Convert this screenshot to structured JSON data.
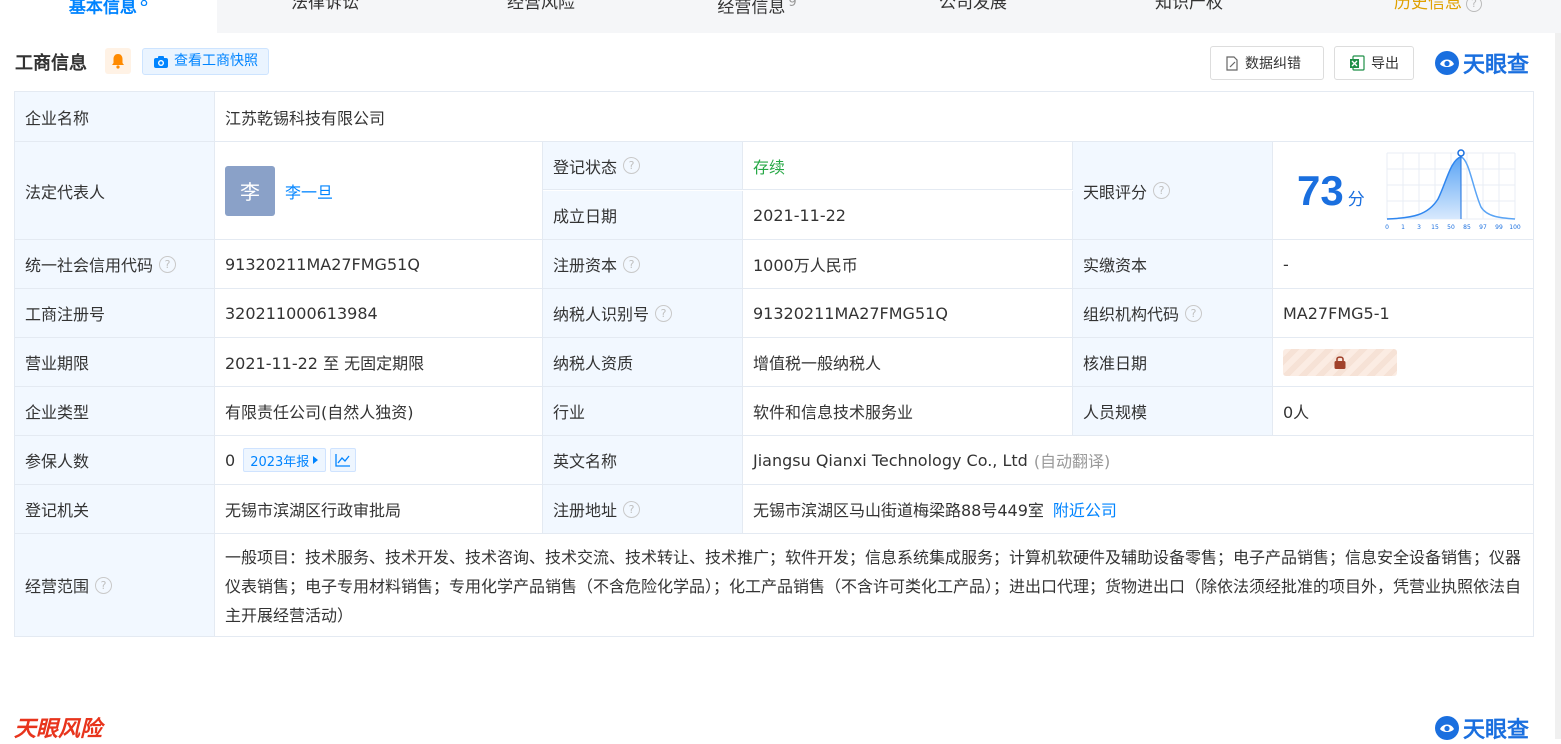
{
  "tabs": [
    {
      "label": "基本信息",
      "count": "8"
    },
    {
      "label": "法律诉讼"
    },
    {
      "label": "经营风险"
    },
    {
      "label": "经营信息",
      "count": "9"
    },
    {
      "label": "公司发展"
    },
    {
      "label": "知识产权"
    },
    {
      "label": "历史信息"
    }
  ],
  "section": {
    "title": "工商信息",
    "snapshot_label": "查看工商快照",
    "correct_label": "数据纠错",
    "export_label": "导出",
    "logo_text": "天眼查"
  },
  "info": {
    "company_name_label": "企业名称",
    "company_name": "江苏乾锡科技有限公司",
    "legal_rep_label": "法定代表人",
    "legal_rep_avatar": "李",
    "legal_rep": "李一旦",
    "status_label": "登记状态",
    "status": "存续",
    "established_label": "成立日期",
    "established": "2021-11-22",
    "score_label": "天眼评分",
    "score": "73",
    "score_unit": "分",
    "score_ticks": [
      "0",
      "1",
      "3",
      "15",
      "50",
      "85",
      "97",
      "99",
      "100"
    ],
    "credit_code_label": "统一社会信用代码",
    "credit_code": "91320211MA27FMG51Q",
    "reg_capital_label": "注册资本",
    "reg_capital": "1000万人民币",
    "paid_capital_label": "实缴资本",
    "paid_capital": "-",
    "reg_no_label": "工商注册号",
    "reg_no": "320211000613984",
    "taxpayer_id_label": "纳税人识别号",
    "taxpayer_id": "91320211MA27FMG51Q",
    "org_code_label": "组织机构代码",
    "org_code": "MA27FMG5-1",
    "term_label": "营业期限",
    "term": "2021-11-22 至 无固定期限",
    "taxpayer_qual_label": "纳税人资质",
    "taxpayer_qual": "增值税一般纳税人",
    "approval_date_label": "核准日期",
    "type_label": "企业类型",
    "type": "有限责任公司(自然人独资)",
    "industry_label": "行业",
    "industry": "软件和信息技术服务业",
    "staff_size_label": "人员规模",
    "staff_size": "0人",
    "insured_label": "参保人数",
    "insured": "0",
    "insured_year": "2023年报",
    "english_name_label": "英文名称",
    "english_name": "Jiangsu Qianxi Technology Co., Ltd",
    "english_note": "(自动翻译)",
    "authority_label": "登记机关",
    "authority": "无锡市滨湖区行政审批局",
    "address_label": "注册地址",
    "address": "无锡市滨湖区马山街道梅梁路88号449室",
    "nearby_label": "附近公司",
    "scope_label": "经营范围",
    "scope": "一般项目：技术服务、技术开发、技术咨询、技术交流、技术转让、技术推广；软件开发；信息系统集成服务；计算机软硬件及辅助设备零售；电子产品销售；信息安全设备销售；仪器仪表销售；电子专用材料销售；专用化学产品销售（不含危险化学品）；化工产品销售（不含许可类化工产品）；进出口代理；货物进出口（除依法须经批准的项目外，凭营业执照依法自主开展经营活动）"
  },
  "footer": {
    "risk_logo": "天眼风险",
    "logo_text": "天眼查"
  }
}
